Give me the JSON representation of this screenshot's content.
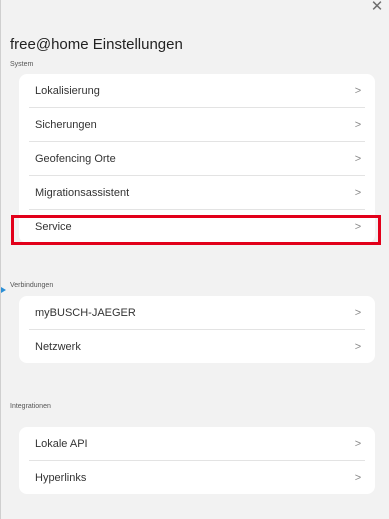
{
  "header": {
    "title": "free@home Einstellungen",
    "close_icon": "close-icon"
  },
  "sections": {
    "system": {
      "label": "System",
      "items": [
        {
          "label": "Lokalisierung"
        },
        {
          "label": "Sicherungen"
        },
        {
          "label": "Geofencing Orte"
        },
        {
          "label": "Migrationsassistent"
        },
        {
          "label": "Service"
        }
      ]
    },
    "verbindungen": {
      "label": "Verbindungen",
      "items": [
        {
          "label": "myBUSCH-JAEGER"
        },
        {
          "label": "Netzwerk"
        }
      ]
    },
    "integrationen": {
      "label": "Integrationen",
      "items": [
        {
          "label": "Lokale API"
        },
        {
          "label": "Hyperlinks"
        }
      ]
    }
  },
  "chevron": ">",
  "close_glyph": "✕",
  "colors": {
    "highlight": "#e2001a",
    "pointer": "#2a8fd6",
    "background": "#f2f2f2"
  }
}
